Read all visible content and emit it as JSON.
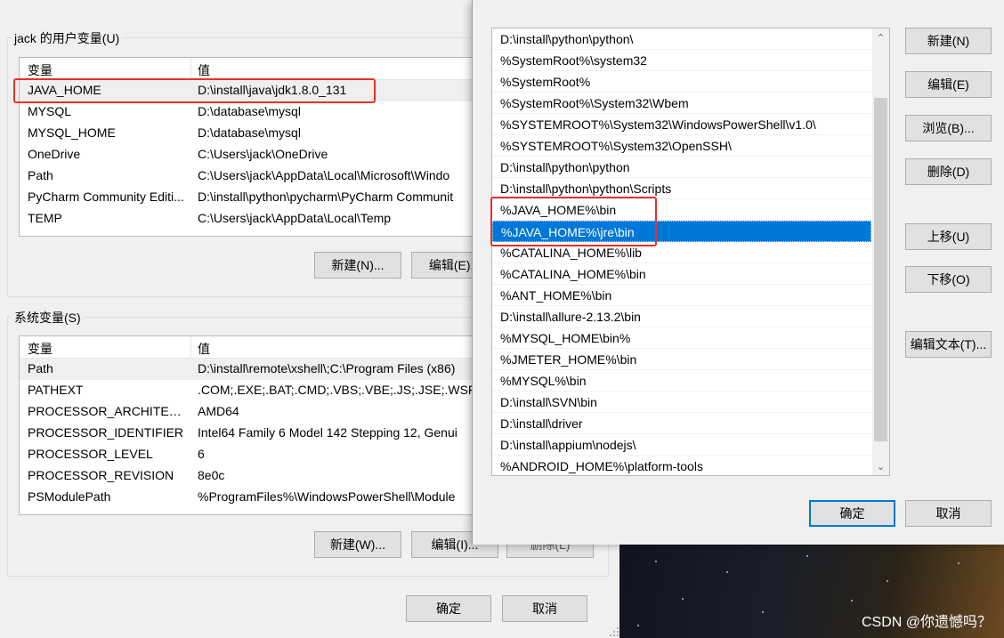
{
  "user_vars": {
    "title": "jack 的用户变量(U)",
    "col_name": "变量",
    "col_value": "值",
    "rows": [
      {
        "name": "JAVA_HOME",
        "value": "D:\\install\\java\\jdk1.8.0_131"
      },
      {
        "name": "MYSQL",
        "value": "D:\\database\\mysql"
      },
      {
        "name": "MYSQL_HOME",
        "value": "D:\\database\\mysql"
      },
      {
        "name": "OneDrive",
        "value": "C:\\Users\\jack\\OneDrive"
      },
      {
        "name": "Path",
        "value": "C:\\Users\\jack\\AppData\\Local\\Microsoft\\Windo"
      },
      {
        "name": "PyCharm Community Editi...",
        "value": "D:\\install\\python\\pycharm\\PyCharm Communit"
      },
      {
        "name": "TEMP",
        "value": "C:\\Users\\jack\\AppData\\Local\\Temp"
      }
    ],
    "new_label": "新建(N)...",
    "edit_label": "编辑(E)..."
  },
  "system_vars": {
    "title": "系统变量(S)",
    "col_name": "变量",
    "col_value": "值",
    "rows": [
      {
        "name": "Path",
        "value": "D:\\install\\remote\\xshell\\;C:\\Program Files (x86)"
      },
      {
        "name": "PATHEXT",
        "value": ".COM;.EXE;.BAT;.CMD;.VBS;.VBE;.JS;.JSE;.WSF;.W"
      },
      {
        "name": "PROCESSOR_ARCHITECT...",
        "value": "AMD64"
      },
      {
        "name": "PROCESSOR_IDENTIFIER",
        "value": "Intel64 Family 6 Model 142 Stepping 12, Genui"
      },
      {
        "name": "PROCESSOR_LEVEL",
        "value": "6"
      },
      {
        "name": "PROCESSOR_REVISION",
        "value": "8e0c"
      },
      {
        "name": "PSModulePath",
        "value": "%ProgramFiles%\\WindowsPowerShell\\Module"
      }
    ],
    "new_label": "新建(W)...",
    "edit_label": "编辑(I)...",
    "delete_label": "删除(L)"
  },
  "bg_dialog": {
    "ok_label": "确定",
    "cancel_label": "取消"
  },
  "path_editor": {
    "entries": [
      "D:\\install\\python\\python\\",
      "%SystemRoot%\\system32",
      "%SystemRoot%",
      "%SystemRoot%\\System32\\Wbem",
      "%SYSTEMROOT%\\System32\\WindowsPowerShell\\v1.0\\",
      "%SYSTEMROOT%\\System32\\OpenSSH\\",
      "D:\\install\\python\\python",
      "D:\\install\\python\\python\\Scripts",
      "%JAVA_HOME%\\bin",
      "%JAVA_HOME%\\jre\\bin",
      "%CATALINA_HOME%\\lib",
      "%CATALINA_HOME%\\bin",
      "%ANT_HOME%\\bin",
      "D:\\install\\allure-2.13.2\\bin",
      "%MYSQL_HOME\\bin%",
      "%JMETER_HOME%\\bin",
      "%MYSQL%\\bin",
      "D:\\install\\SVN\\bin",
      "D:\\install\\driver",
      "D:\\install\\appium\\nodejs\\",
      "%ANDROID_HOME%\\platform-tools"
    ],
    "selected_index": 9,
    "buttons": {
      "new": "新建(N)",
      "edit": "编辑(E)",
      "browse": "浏览(B)...",
      "delete": "删除(D)",
      "move_up": "上移(U)",
      "move_down": "下移(O)",
      "edit_text": "编辑文本(T)...",
      "ok": "确定",
      "cancel": "取消"
    }
  },
  "watermark": "CSDN @你遗憾吗？",
  "colors": {
    "selection": "#0078d7",
    "highlight_box": "#e8312c"
  }
}
